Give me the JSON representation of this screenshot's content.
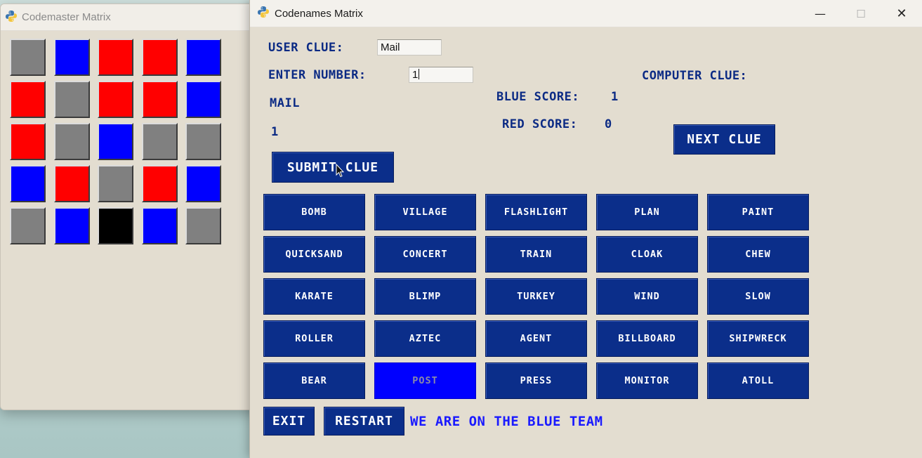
{
  "codemaster_window": {
    "title": "Codemaster Matrix",
    "colors": {
      "gray": "#808080",
      "blue": "#0000ff",
      "red": "#ff0000",
      "black": "#000000"
    },
    "matrix": [
      [
        "gray",
        "blue",
        "red",
        "red",
        "blue"
      ],
      [
        "red",
        "gray",
        "red",
        "red",
        "blue"
      ],
      [
        "red",
        "gray",
        "blue",
        "gray",
        "gray"
      ],
      [
        "blue",
        "red",
        "gray",
        "red",
        "blue"
      ],
      [
        "gray",
        "blue",
        "black",
        "blue",
        "gray"
      ]
    ]
  },
  "codenames_window": {
    "title": "Codenames Matrix",
    "controls": {
      "minimize": "—",
      "maximize": "☐",
      "close": "✕"
    },
    "user_clue_label": "USER CLUE:",
    "user_clue_value": "Mail",
    "enter_number_label": "ENTER NUMBER:",
    "enter_number_value": "1",
    "submitted_clue": "MAIL",
    "submitted_number": "1",
    "submit_button": "SUBMIT CLUE",
    "computer_clue_label": "COMPUTER CLUE:",
    "blue_score_label": "BLUE SCORE:",
    "blue_score": "1",
    "red_score_label": "RED SCORE:",
    "red_score": "0",
    "next_clue_button": "NEXT CLUE",
    "exit_button": "EXIT",
    "restart_button": "RESTART",
    "team_message": "WE ARE ON THE BLUE TEAM",
    "words": [
      "BOMB",
      "VILLAGE",
      "FLASHLIGHT",
      "PLAN",
      "PAINT",
      "QUICKSAND",
      "CONCERT",
      "TRAIN",
      "CLOAK",
      "CHEW",
      "KARATE",
      "BLIMP",
      "TURKEY",
      "WIND",
      "SLOW",
      "ROLLER",
      "AZTEC",
      "AGENT",
      "BILLBOARD",
      "SHIPWRECK",
      "BEAR",
      "POST",
      "PRESS",
      "MONITOR",
      "ATOLL"
    ],
    "revealed_words": [
      "POST"
    ]
  }
}
